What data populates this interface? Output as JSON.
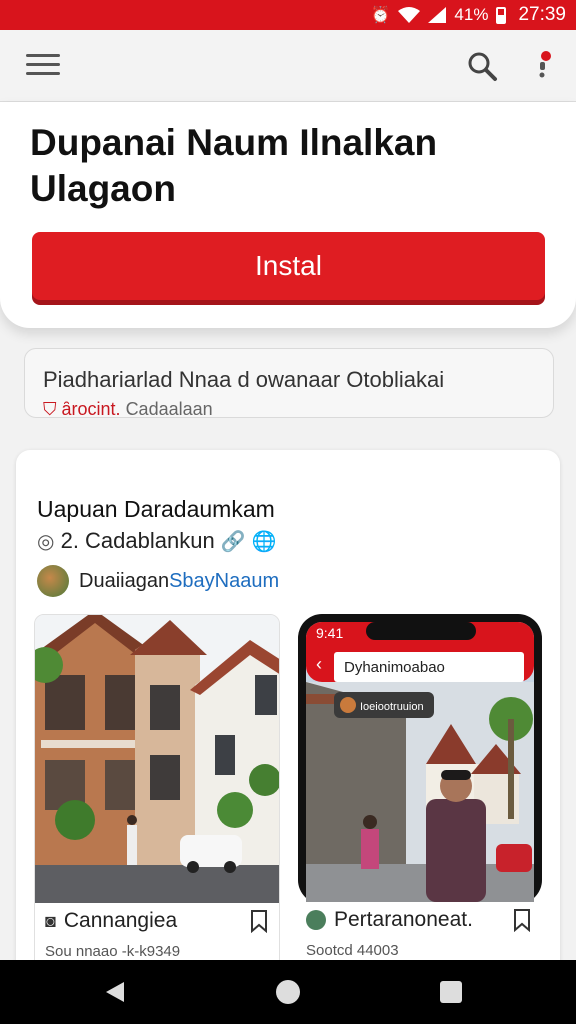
{
  "status_bar": {
    "battery_text": "41%",
    "time": "27:39"
  },
  "hero": {
    "title": "Dupanai Naum Ilnalkan Ulagaon",
    "install_label": "Instal"
  },
  "info": {
    "line1": "Piadhariarlad Nnaa d owanaar Otobliakai",
    "line2_red": "ȃrocint.",
    "line2_grey": "Cadaalaan"
  },
  "card": {
    "title": "Uapuan Daradaumkam",
    "subtitle": "2. Cadablankun",
    "author_name": "Duaiiagan",
    "author_suffix": "SbayNaaum"
  },
  "thumbs": [
    {
      "caption": "Cannangiea",
      "meta": "Sou nnaao -k-k9349"
    },
    {
      "caption": "Pertaranoneat.",
      "meta": "Sootcd 44003",
      "phone_time": "9:41",
      "phone_header": "Dyhanimoabao",
      "phone_tag": "Ioeiootruuion"
    }
  ],
  "colors": {
    "accent": "#d8141c",
    "install": "#df1d22",
    "nav": "#000000"
  },
  "icons": [
    "menu-icon",
    "search-icon",
    "notification-icon",
    "bookmark-icon",
    "back-icon",
    "home-icon",
    "recents-icon"
  ]
}
